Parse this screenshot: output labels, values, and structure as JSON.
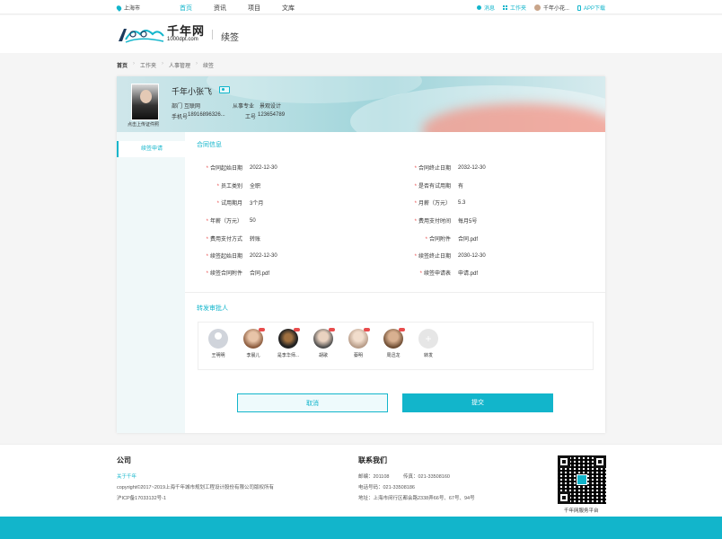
{
  "topbar": {
    "location": "上海市",
    "nav": [
      "首页",
      "资讯",
      "项目",
      "文库"
    ],
    "messages": "消息",
    "workbench": "工作夹",
    "user": "千年小花...",
    "app_download": "APP下载"
  },
  "header": {
    "logo_cn": "千年网",
    "logo_en": "1000dpt.com",
    "page_title": "续签"
  },
  "breadcrumb": [
    "首页",
    "工作夹",
    "人事管理",
    "续签"
  ],
  "profile": {
    "name": "千年小张飞",
    "photo_hint": "点击上传证件照",
    "dept_label": "部门",
    "dept": "互联网",
    "major_label": "从事专业",
    "major": "景观设计",
    "phone_label": "手机号",
    "phone": "18916896326...",
    "id_label": "工号",
    "id": "123654789"
  },
  "sidebar": {
    "item": "续签申请"
  },
  "contract": {
    "title": "合同信息",
    "left": [
      {
        "label": "合同起始日期",
        "value": "2022-12-30"
      },
      {
        "label": "员工类别",
        "value": "全职"
      },
      {
        "label": "试用期月",
        "value": "3个月"
      },
      {
        "label": "年薪（万元）",
        "value": "50"
      },
      {
        "label": "费用支付方式",
        "value": "转账"
      },
      {
        "label": "续签起始日期",
        "value": "2022-12-30"
      },
      {
        "label": "续签合同附件",
        "value": "合同.pdf"
      }
    ],
    "right": [
      {
        "label": "合同终止日期",
        "value": "2032-12-30"
      },
      {
        "label": "是否有试用期",
        "value": "有"
      },
      {
        "label": "月薪（万元）",
        "value": "5.3"
      },
      {
        "label": "费用支付时间",
        "value": "每月5号"
      },
      {
        "label": "合同附件",
        "value": "合同.pdf"
      },
      {
        "label": "续签终止日期",
        "value": "2030-12-30"
      },
      {
        "label": "续签申请表",
        "value": "申请.pdf"
      }
    ]
  },
  "approvers": {
    "title": "转发审批人",
    "people": [
      "王明明",
      "李晨儿",
      "是李华师...",
      "胡歌",
      "蔡明",
      "周迅龙"
    ],
    "add_label": "转发"
  },
  "buttons": {
    "cancel": "取消",
    "submit": "提交"
  },
  "footer": {
    "company_title": "公司",
    "about": "关于千年",
    "copyright": "copyright©2017~2019上海千年城市规划工程设计股份有限公司版权所有",
    "icp": "沪ICP备17033132号-1",
    "contact_title": "联系我们",
    "postcode": "邮编：201108",
    "fax": "传真：021-33508160",
    "tel": "电话号码：021-33508186",
    "address": "地址：上海市闵行区都会路2338弄66号、67号、94号",
    "qr_caption": "千年网服务平台"
  }
}
